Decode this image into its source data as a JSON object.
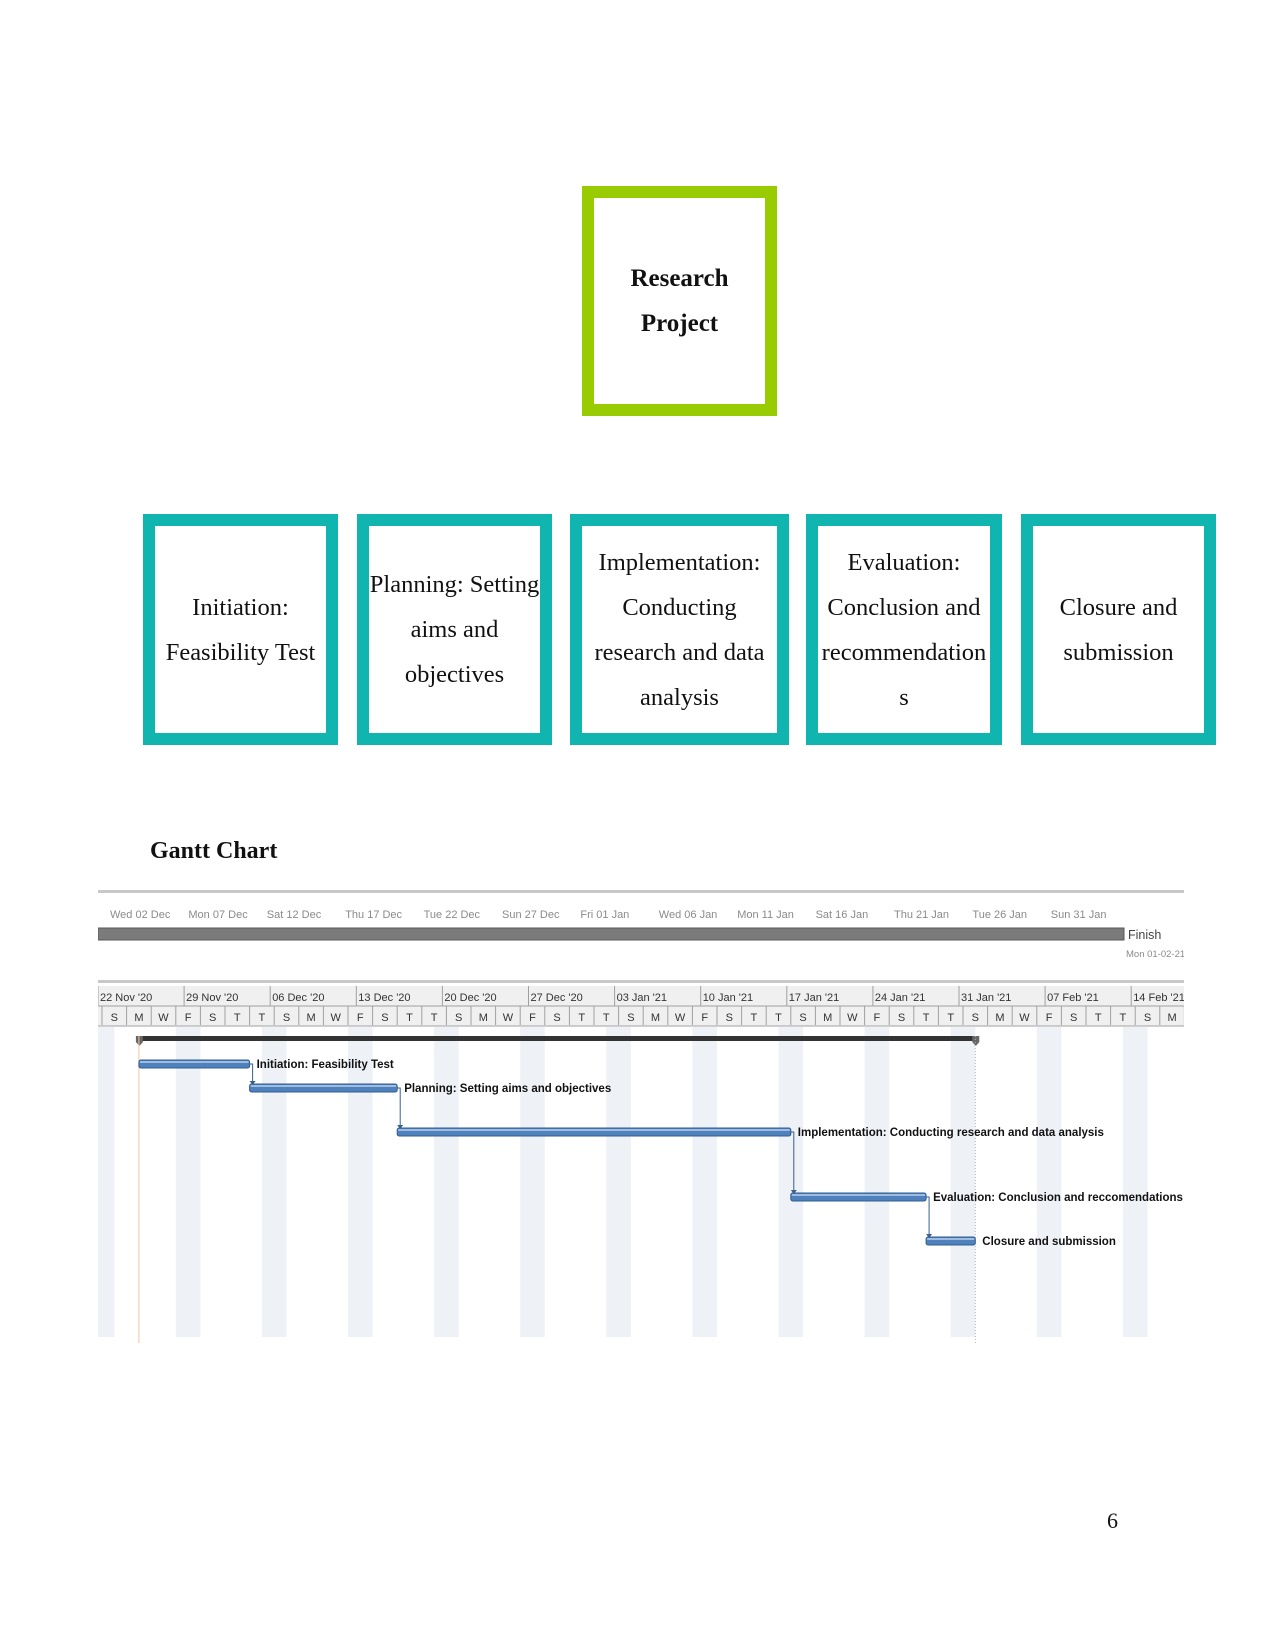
{
  "org_chart": {
    "root": {
      "label": "Research Project",
      "lines": [
        "Research",
        "Project"
      ],
      "border_color": "#99cc00"
    },
    "phase_border_color": "#0fb5ae",
    "phases": [
      {
        "label": "Initiation: Feasibility Test",
        "lines": [
          "Initiation:",
          "Feasibility Test"
        ]
      },
      {
        "label": "Planning: Setting aims and objectives",
        "lines": [
          "Planning: Setting",
          "aims and",
          "objectives"
        ]
      },
      {
        "label": "Implementation: Conducting research and data analysis",
        "lines": [
          "Implementation:",
          "Conducting",
          "research and data",
          "analysis"
        ]
      },
      {
        "label": "Evaluation: Conclusion and recommendations",
        "lines": [
          "Evaluation:",
          "Conclusion and",
          "recommendation",
          "s"
        ]
      },
      {
        "label": "Closure and submission",
        "lines": [
          "Closure and",
          "submission"
        ]
      }
    ]
  },
  "gantt": {
    "title": "Gantt Chart",
    "timeline": {
      "labels": [
        "Wed 02 Dec",
        "Mon 07 Dec",
        "Sat 12 Dec",
        "Thu 17 Dec",
        "Tue 22 Dec",
        "Sun 27 Dec",
        "Fri 01 Jan",
        "Wed 06 Jan",
        "Mon 11 Jan",
        "Sat 16 Jan",
        "Thu 21 Jan",
        "Tue 26 Jan",
        "Sun 31 Jan"
      ],
      "finish_label": "Finish",
      "finish_date": "Mon 01-02-21"
    },
    "week_headers": [
      "22 Nov '20",
      "29 Nov '20",
      "06 Dec '20",
      "13 Dec '20",
      "20 Dec '20",
      "27 Dec '20",
      "03 Jan '21",
      "10 Jan '21",
      "17 Jan '21",
      "24 Jan '21",
      "31 Jan '21",
      "07 Feb '21",
      "14 Feb '21"
    ],
    "day_letters": [
      "S",
      "M",
      "W",
      "F",
      "S",
      "T",
      "T"
    ],
    "bar_color": "#4f81bd",
    "summary_color": "#333333"
  },
  "chart_data": {
    "type": "gantt",
    "title": "Gantt Chart",
    "x_axis": "dates (weeks starting Sunday)",
    "x_range": [
      "2020-11-22",
      "2021-02-17"
    ],
    "project_summary": {
      "start": "2020-11-25",
      "end": "2021-02-01"
    },
    "tasks": [
      {
        "name": "Initiation: Feasibility Test",
        "start": "2020-11-25",
        "end": "2020-12-04",
        "predecessor": null
      },
      {
        "name": "Planning: Setting aims and objectives",
        "start": "2020-12-04",
        "end": "2020-12-16",
        "predecessor": "Initiation: Feasibility Test"
      },
      {
        "name": "Implementation: Conducting research and data analysis",
        "start": "2020-12-16",
        "end": "2021-01-17",
        "predecessor": "Planning: Setting aims and objectives"
      },
      {
        "name": "Evaluation: Conclusion and reccomendations",
        "start": "2021-01-17",
        "end": "2021-01-28",
        "predecessor": "Implementation: Conducting research and data analysis"
      },
      {
        "name": "Closure and submission",
        "start": "2021-01-28",
        "end": "2021-02-01",
        "predecessor": "Evaluation: Conclusion and reccomendations"
      }
    ]
  },
  "page": {
    "number": "6"
  }
}
